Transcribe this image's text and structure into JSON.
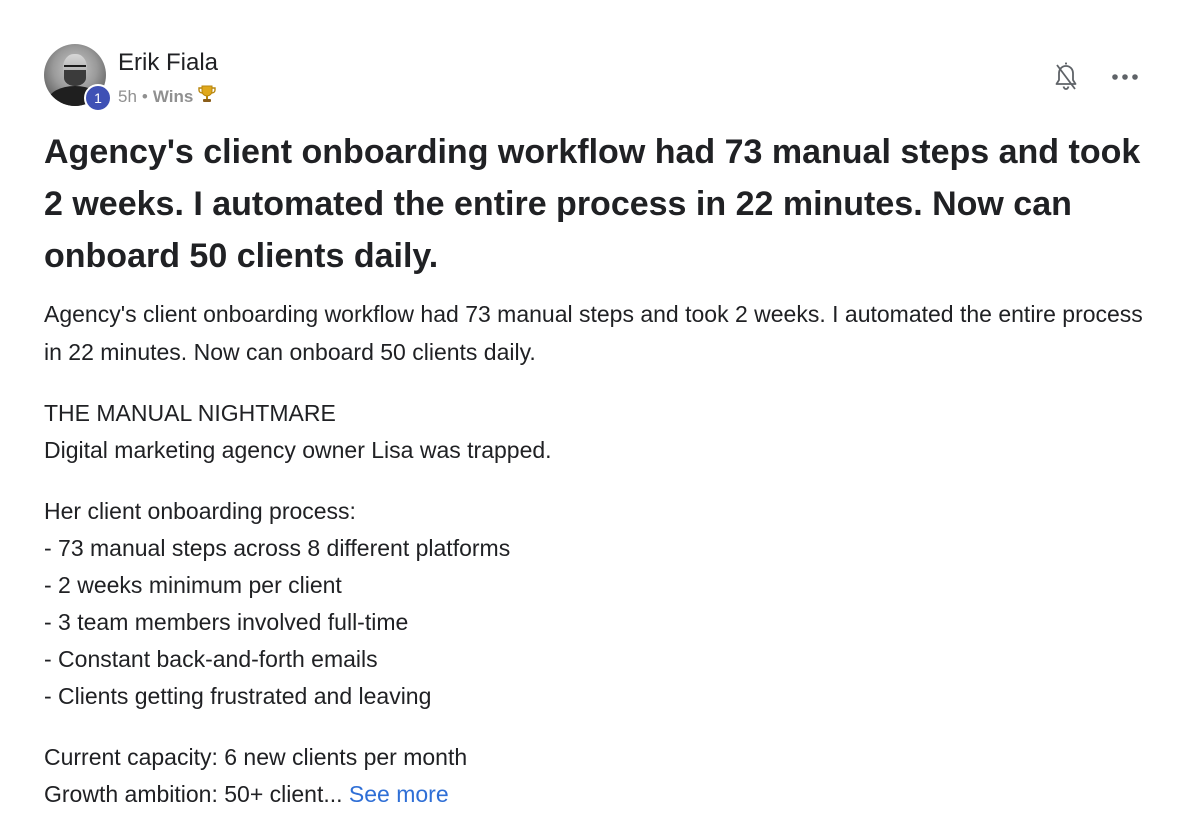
{
  "author": {
    "name": "Erik Fiala",
    "level": "1",
    "time_ago": "5h",
    "separator": "•",
    "category": "Wins",
    "category_icon": "trophy-icon"
  },
  "actions": {
    "notification_icon": "bell-off-icon",
    "more_icon": "more-horizontal-icon"
  },
  "post": {
    "title": "Agency's client onboarding workflow had 73 manual steps and took 2 weeks. I automated the entire process in 22 minutes. Now can onboard 50 clients daily.",
    "intro": "Agency's client onboarding workflow had 73 manual steps and took 2 weeks. I automated the entire process in 22 minutes. Now can onboard 50 clients daily.",
    "section_heading": "THE MANUAL NIGHTMARE",
    "section_line": "Digital marketing agency owner Lisa was trapped.",
    "process_heading": "Her client onboarding process:",
    "process_items": [
      "- 73 manual steps across 8 different platforms",
      "- 2 weeks minimum per client",
      "- 3 team members involved full-time",
      "- Constant back-and-forth emails",
      "- Clients getting frustrated and leaving"
    ],
    "capacity_line": "Current capacity: 6 new clients per month",
    "ambition_line": "Growth ambition: 50+ client...",
    "see_more_label": "See more"
  },
  "colors": {
    "text": "#202124",
    "muted": "#909090",
    "link": "#2f6fd6",
    "badge": "#3f51b5"
  }
}
